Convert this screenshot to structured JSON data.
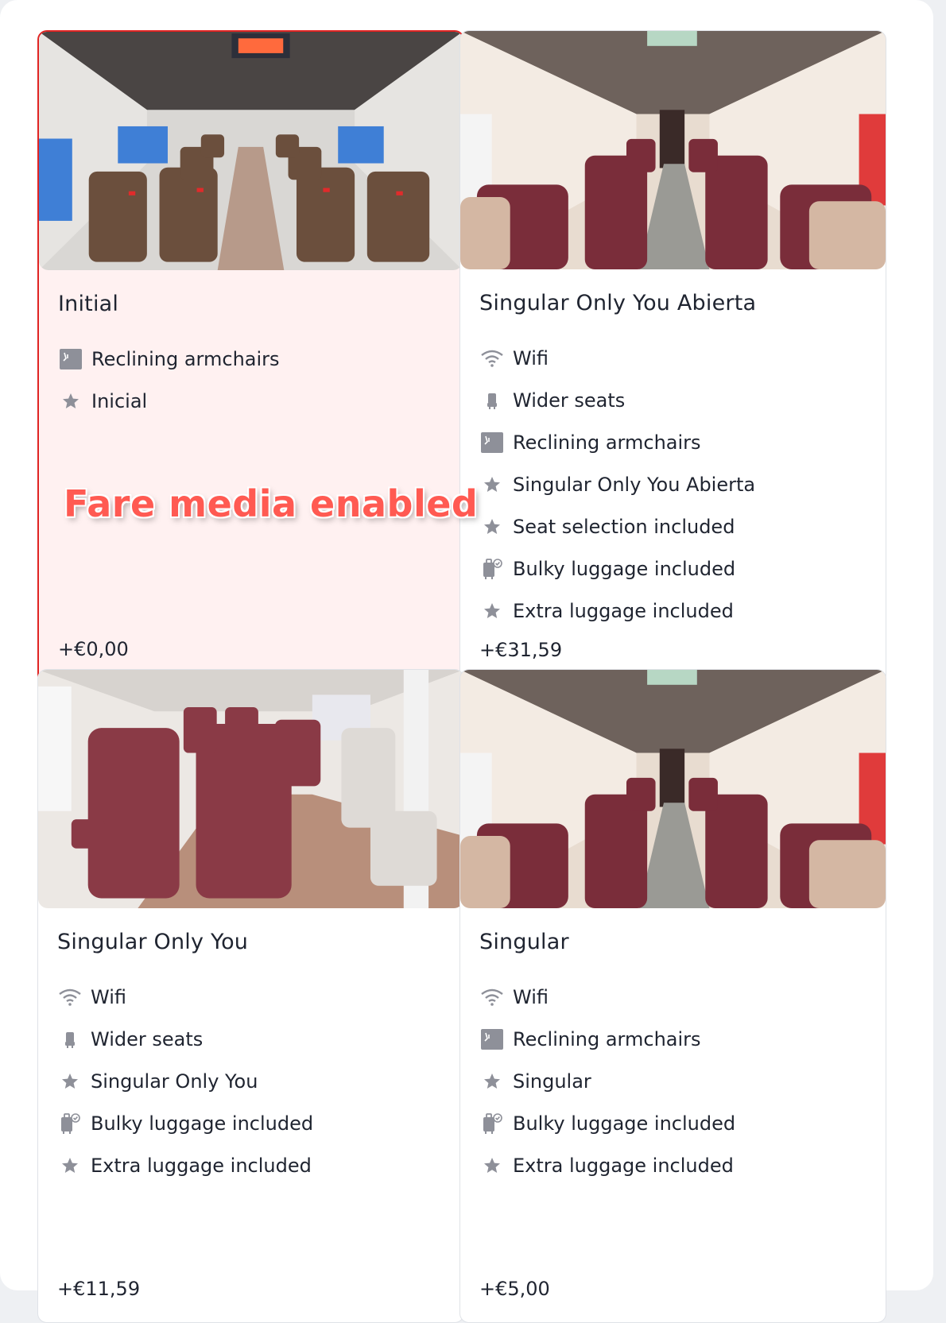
{
  "overlay_label": "Fare media enabled",
  "colors": {
    "selected_border": "#e02423",
    "selected_background": "#fff1f1",
    "icon_gray": "#8e9099",
    "overlay_text": "#ff5a52"
  },
  "cards": [
    {
      "title": "Initial",
      "selected": true,
      "photo": "train-interior-brown-seats",
      "features": [
        {
          "icon": "reclining-armchair-icon",
          "label": "Reclining armchairs"
        },
        {
          "icon": "star-icon",
          "label": "Inicial"
        }
      ],
      "price": "+€0,00"
    },
    {
      "title": "Singular Only You Abierta",
      "selected": false,
      "photo": "train-interior-burgundy-seats",
      "features": [
        {
          "icon": "wifi-icon",
          "label": "Wifi"
        },
        {
          "icon": "seat-icon",
          "label": "Wider seats"
        },
        {
          "icon": "reclining-armchair-icon",
          "label": "Reclining armchairs"
        },
        {
          "icon": "star-icon",
          "label": "Singular Only You Abierta"
        },
        {
          "icon": "star-icon",
          "label": "Seat selection included"
        },
        {
          "icon": "luggage-check-icon",
          "label": "Bulky luggage included"
        },
        {
          "icon": "star-icon",
          "label": "Extra luggage included"
        }
      ],
      "price": "+€31,59"
    },
    {
      "title": "Singular Only You",
      "selected": false,
      "photo": "train-interior-burgundy-single-seats",
      "features": [
        {
          "icon": "wifi-icon",
          "label": "Wifi"
        },
        {
          "icon": "seat-icon",
          "label": "Wider seats"
        },
        {
          "icon": "star-icon",
          "label": "Singular Only You"
        },
        {
          "icon": "luggage-check-icon",
          "label": "Bulky luggage included"
        },
        {
          "icon": "star-icon",
          "label": "Extra luggage included"
        }
      ],
      "price": "+€11,59"
    },
    {
      "title": "Singular",
      "selected": false,
      "photo": "train-interior-burgundy-seats",
      "features": [
        {
          "icon": "wifi-icon",
          "label": "Wifi"
        },
        {
          "icon": "reclining-armchair-icon",
          "label": "Reclining armchairs"
        },
        {
          "icon": "star-icon",
          "label": "Singular"
        },
        {
          "icon": "luggage-check-icon",
          "label": "Bulky luggage included"
        },
        {
          "icon": "star-icon",
          "label": "Extra luggage included"
        }
      ],
      "price": "+€5,00"
    }
  ]
}
